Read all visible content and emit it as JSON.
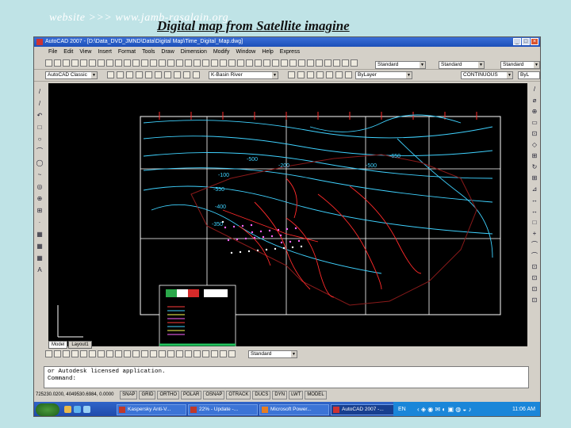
{
  "slide": {
    "website": "website >>> www.jamb-rasalain.org",
    "title": "Digital map from Satellite imagine"
  },
  "window": {
    "title": "AutoCAD 2007 - [D:\\Data_DVD_JMND\\Data\\Digital Map\\Time_Digital_Map.dwg]"
  },
  "menu": [
    "File",
    "Edit",
    "View",
    "Insert",
    "Format",
    "Tools",
    "Draw",
    "Dimension",
    "Modify",
    "Window",
    "Help",
    "Express"
  ],
  "toolbar": {
    "workspace": "AutoCAD Classic",
    "layer": "K-Basin River",
    "color": "ByLayer",
    "linetype": "CONTINUOUS",
    "lineweight": "ByL",
    "text_style": "Standard",
    "dim_style": "Standard",
    "table_style": "Standard",
    "dimbar_style": "Standard"
  },
  "left_tools": [
    "/",
    "/",
    "↶",
    "□",
    "○",
    "⌒",
    "◯",
    "~",
    "◎",
    "⊕",
    "⊞",
    "·",
    "▦",
    "▦",
    "▦",
    "A"
  ],
  "right_tools": [
    "/",
    "⌀",
    "⊕",
    "▭",
    "⊡",
    "◇",
    "⊞",
    "↻",
    "⊞",
    "⊿",
    "↔",
    "↔",
    "□",
    "+",
    "⌒",
    "⌒",
    "⊡",
    "⊡",
    "⊡",
    "⊡"
  ],
  "map": {
    "contour_labels": [
      "-500",
      "-100",
      "-550",
      "-400",
      "-350",
      "-200",
      "-500",
      "-650"
    ]
  },
  "tabs": [
    "Model",
    "Layout1"
  ],
  "command": {
    "line1": "or Autodesk licensed application.",
    "line2": "Command:"
  },
  "status": {
    "coords": "725230.0200, 4049530.6984, 0.0000",
    "buttons": [
      "SNAP",
      "GRID",
      "ORTHO",
      "POLAR",
      "OSNAP",
      "OTRACK",
      "DUCS",
      "DYN",
      "LWT",
      "MODEL"
    ]
  },
  "taskbar": {
    "items": [
      "Kaspersky Anti-V...",
      "22% - Update -...",
      "Microsoft Power...",
      "AutoCAD 2007 -..."
    ],
    "lang": "EN",
    "time": "11:06 AM"
  },
  "colors": {
    "contour": "#3fd2ff",
    "river": "#ff2a2a",
    "grid": "#ffffff",
    "coast": "#8b1a1a"
  }
}
